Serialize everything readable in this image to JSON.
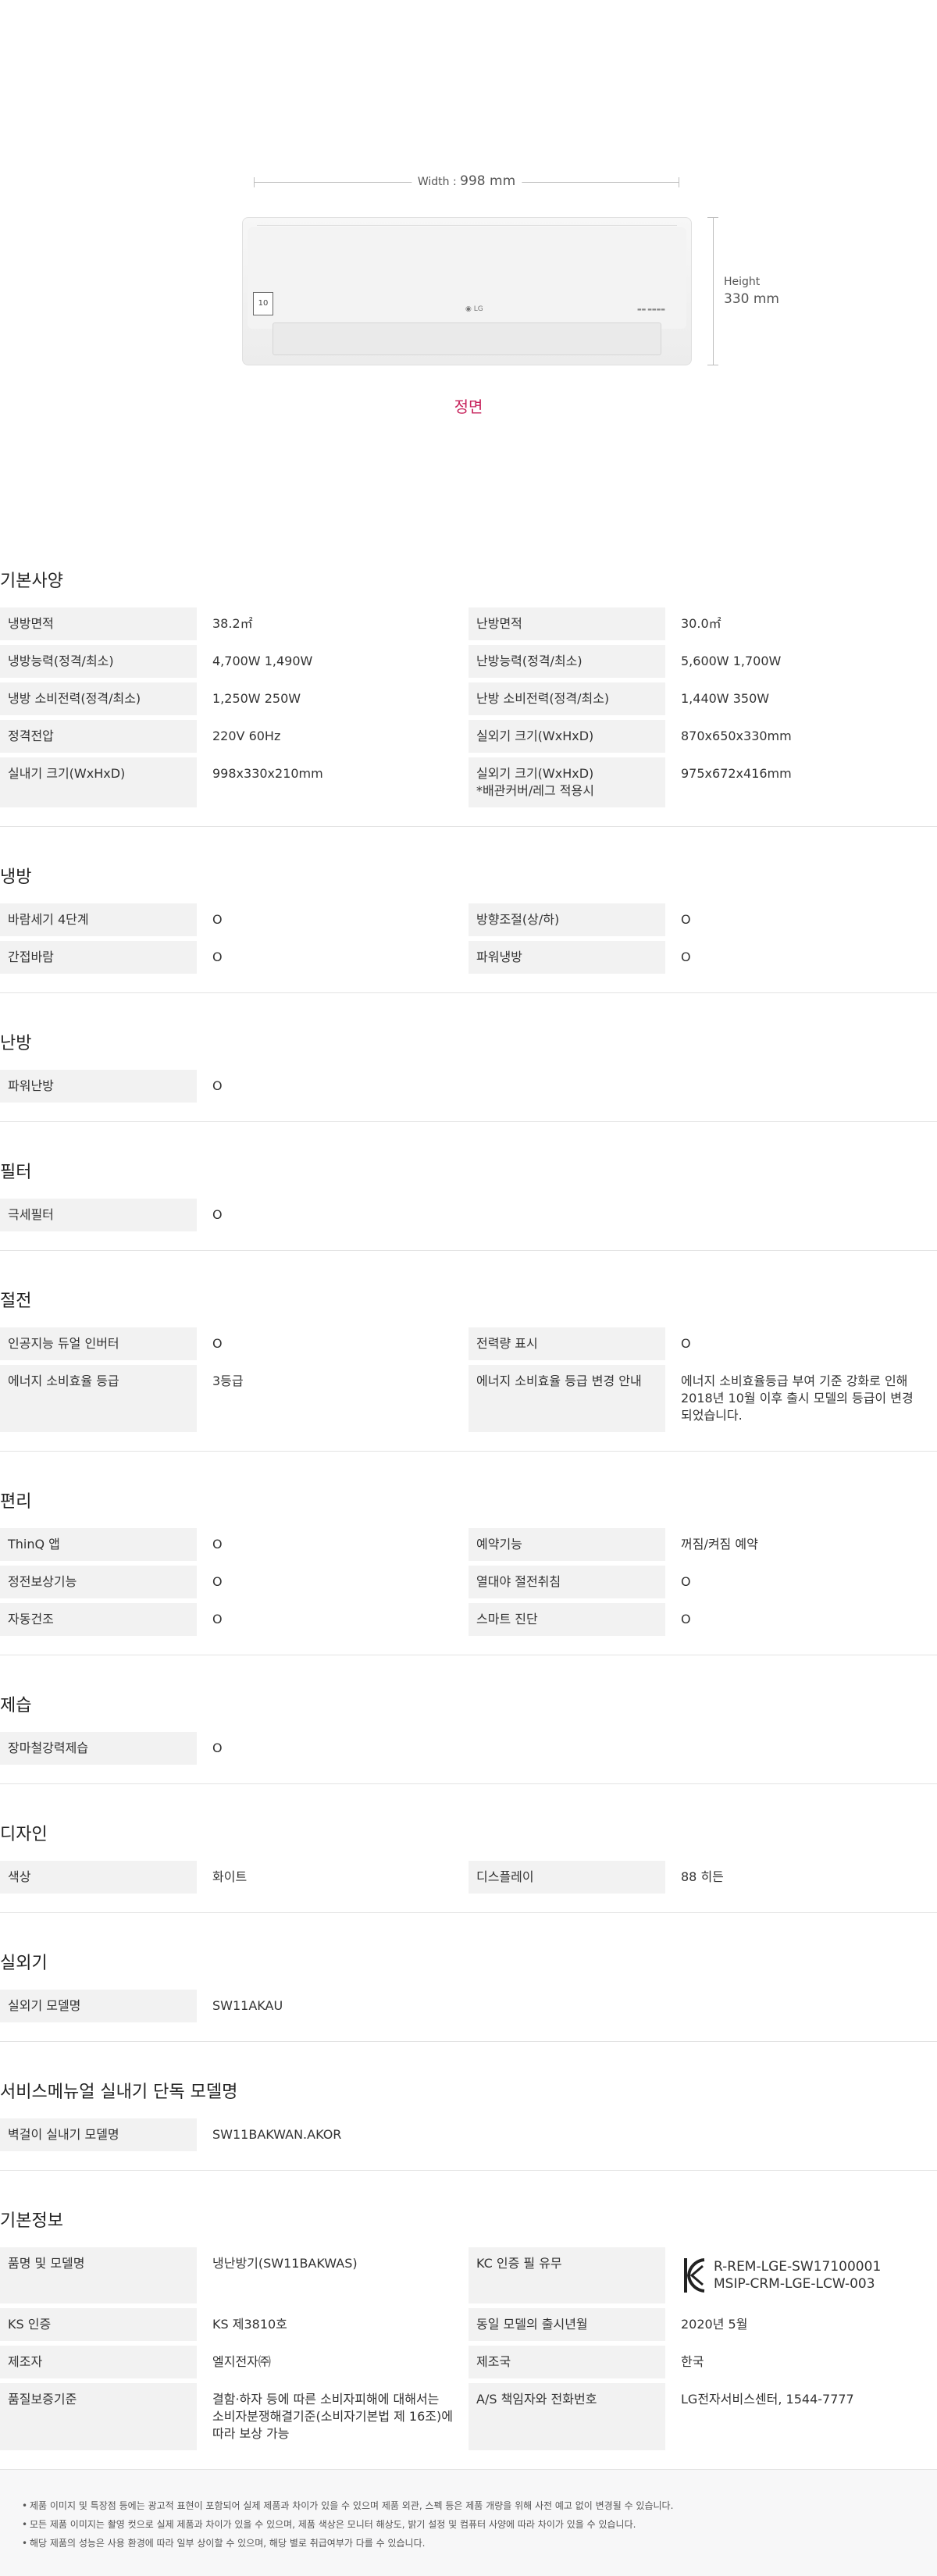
{
  "hero": {
    "width_label": "Width : ",
    "width_value": "998 mm",
    "height_label": "Height",
    "height_value": "330 mm",
    "view_label": "정면"
  },
  "sections": [
    {
      "title": "기본사양",
      "rows": [
        {
          "left": {
            "key": "냉방면적",
            "val": "38.2㎡"
          },
          "right": {
            "key": "난방면적",
            "val": "30.0㎡"
          }
        },
        {
          "left": {
            "key": "냉방능력(정격/최소)",
            "val": "4,700W  1,490W"
          },
          "right": {
            "key": "난방능력(정격/최소)",
            "val": "5,600W  1,700W"
          }
        },
        {
          "left": {
            "key": "냉방 소비전력(정격/최소)",
            "val": "1,250W  250W"
          },
          "right": {
            "key": "난방 소비전력(정격/최소)",
            "val": "1,440W  350W"
          }
        },
        {
          "left": {
            "key": "정격전압",
            "val": "220V  60Hz"
          },
          "right": {
            "key": "실외기 크기(WxHxD)",
            "val": "870x650x330mm"
          }
        },
        {
          "left": {
            "key": "실내기 크기(WxHxD)",
            "val": "998x330x210mm"
          },
          "right": {
            "key": "실외기 크기(WxHxD)\n        *배관커버/레그 적용시",
            "val": "975x672x416mm"
          }
        }
      ]
    },
    {
      "title": "냉방",
      "rows": [
        {
          "left": {
            "key": "바람세기 4단계",
            "val": "O"
          },
          "right": {
            "key": "방향조절(상/하)",
            "val": "O"
          }
        },
        {
          "left": {
            "key": "간접바람",
            "val": "O"
          },
          "right": {
            "key": "파워냉방",
            "val": "O"
          }
        }
      ]
    },
    {
      "title": "난방",
      "rows": [
        {
          "left": {
            "key": "파워난방",
            "val": "O"
          }
        }
      ]
    },
    {
      "title": "필터",
      "rows": [
        {
          "left": {
            "key": "극세필터",
            "val": "O"
          }
        }
      ]
    },
    {
      "title": "절전",
      "rows": [
        {
          "left": {
            "key": "인공지능 듀얼 인버터",
            "val": "O"
          },
          "right": {
            "key": "전력량 표시",
            "val": "O"
          }
        },
        {
          "left": {
            "key": "에너지 소비효율 등급",
            "val": "3등급"
          },
          "right": {
            "key": "에너지 소비효율 등급 변경 안내",
            "val": "에너지 소비효율등급 부여 기준 강화로 인해 2018년 10월 이후 출시 모델의 등급이 변경되었습니다."
          }
        }
      ]
    },
    {
      "title": "편리",
      "rows": [
        {
          "left": {
            "key": "ThinQ 앱",
            "val": "O"
          },
          "right": {
            "key": "예약기능",
            "val": "꺼짐/켜짐 예약"
          }
        },
        {
          "left": {
            "key": "정전보상기능",
            "val": "O"
          },
          "right": {
            "key": "열대야 절전취침",
            "val": "O"
          }
        },
        {
          "left": {
            "key": "자동건조",
            "val": "O"
          },
          "right": {
            "key": "스마트 진단",
            "val": "O"
          }
        }
      ]
    },
    {
      "title": "제습",
      "rows": [
        {
          "left": {
            "key": "장마철강력제습",
            "val": "O"
          }
        }
      ]
    },
    {
      "title": "디자인",
      "rows": [
        {
          "left": {
            "key": "색상",
            "val": "화이트"
          },
          "right": {
            "key": "디스플레이",
            "val": "88 히든"
          }
        }
      ]
    },
    {
      "title": "실외기",
      "rows": [
        {
          "left": {
            "key": "실외기 모델명",
            "val": "SW11AKAU"
          }
        }
      ]
    },
    {
      "title": "서비스메뉴얼 실내기 단독 모델명",
      "rows": [
        {
          "left": {
            "key": "벽걸이 실내기 모델명",
            "val": "SW11BAKWAN.AKOR"
          }
        }
      ]
    },
    {
      "title": "기본정보",
      "rows": [
        {
          "left": {
            "key": "품명 및 모델명",
            "val": "냉난방기(SW11BAKWAS)"
          },
          "right": {
            "key": "KC 인증 필 유무",
            "val": "R-REM-LGE-SW17100001\nMSIP-CRM-LGE-LCW-003",
            "kc": true
          }
        },
        {
          "left": {
            "key": "KS 인증",
            "val": "KS 제3810호"
          },
          "right": {
            "key": "동일 모델의 출시년월",
            "val": "2020년 5월"
          }
        },
        {
          "left": {
            "key": "제조자",
            "val": "엘지전자㈜"
          },
          "right": {
            "key": "제조국",
            "val": "한국"
          }
        },
        {
          "left": {
            "key": "품질보증기준",
            "val": "결함·하자 등에 따른 소비자피해에 대해서는 소비자분쟁해결기준(소비자기본법 제 16조)에 따라 보상 가능"
          },
          "right": {
            "key": "A/S 책임자와 전화번호",
            "val": "LG전자서비스센터, 1544-7777"
          }
        }
      ]
    }
  ],
  "notes": [
    "제품 이미지 및 특장점 등에는 광고적 표현이 포함되어 실제 제품과 차이가 있을 수 있으며 제품 외관, 스펙 등은 제품 개량을 위해 사전 예고 없이 변경될 수 있습니다.",
    "모든 제품 이미지는 촬영 컷으로 실제 제품과 차이가 있을 수 있으며, 제품 색상은 모니터 해상도, 밝기 설정 및 컴퓨터 사양에 따라 차이가 있을 수 있습니다.",
    "해당 제품의 성능은 사용 환경에 따라 일부 상이할 수 있으며, 해당 별로 취급여부가 다를 수 있습니다."
  ]
}
